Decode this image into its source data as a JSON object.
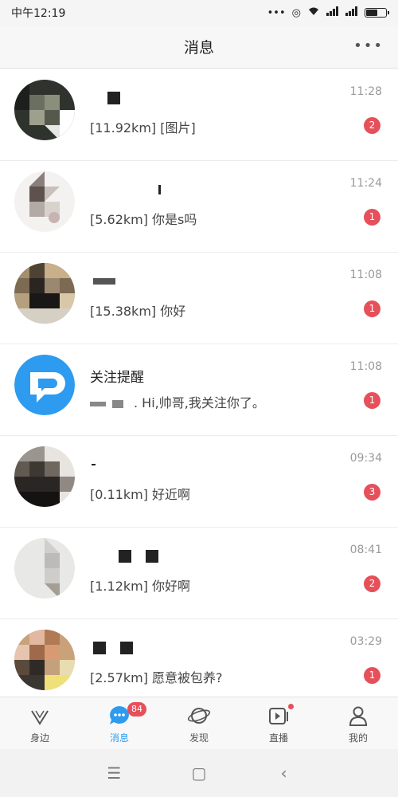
{
  "status_bar": {
    "time": "中午12:19",
    "battery_level": 0.55
  },
  "header": {
    "title": "消息",
    "more_label": "•••"
  },
  "messages": [
    {
      "name": "",
      "preview": "[11.92km] [图片]",
      "time": "11:28",
      "badge": "2",
      "avatar_icon": "pixelated-avatar"
    },
    {
      "name": "",
      "preview": "[5.62km] 你是s吗",
      "time": "11:24",
      "badge": "1",
      "avatar_icon": "pixelated-avatar"
    },
    {
      "name": "",
      "preview": "[15.38km] 你好",
      "time": "11:08",
      "badge": "1",
      "avatar_icon": "pixelated-avatar"
    },
    {
      "name": "关注提醒",
      "preview": ". Hi,帅哥,我关注你了。",
      "time": "11:08",
      "badge": "1",
      "avatar_icon": "follow-reminder-icon"
    },
    {
      "name": "",
      "preview": "[0.11km] 好近啊",
      "time": "09:34",
      "badge": "3",
      "avatar_icon": "pixelated-avatar"
    },
    {
      "name": "",
      "preview": "[1.12km] 你好啊",
      "time": "08:41",
      "badge": "2",
      "avatar_icon": "pixelated-avatar"
    },
    {
      "name": "",
      "preview": "[2.57km] 愿意被包养?",
      "time": "03:29",
      "badge": "1",
      "avatar_icon": "pixelated-avatar"
    }
  ],
  "tabs": [
    {
      "label": "身边",
      "icon": "nearby-icon"
    },
    {
      "label": "消息",
      "icon": "message-icon",
      "badge": "84",
      "active": true
    },
    {
      "label": "发现",
      "icon": "planet-icon"
    },
    {
      "label": "直播",
      "icon": "live-icon"
    },
    {
      "label": "我的",
      "icon": "profile-icon"
    }
  ],
  "system_nav": {
    "menu": "☰",
    "home": "▢",
    "back": "‹"
  },
  "colors": {
    "accent": "#2c9bf0",
    "badge": "#e5505a"
  }
}
